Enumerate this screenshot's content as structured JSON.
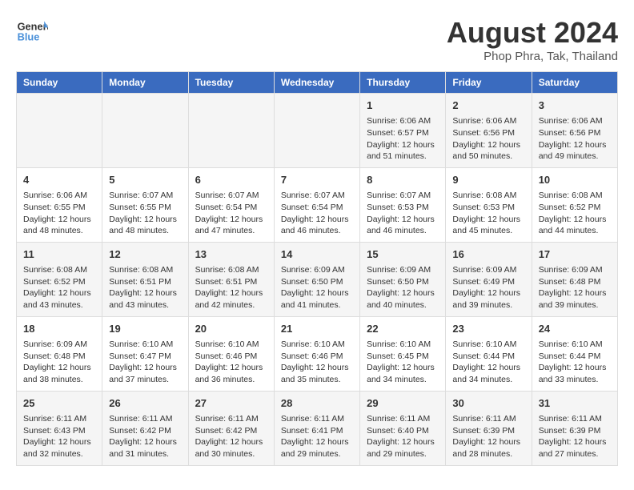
{
  "header": {
    "logo_line1": "General",
    "logo_line2": "Blue",
    "month": "August 2024",
    "location": "Phop Phra, Tak, Thailand"
  },
  "days_of_week": [
    "Sunday",
    "Monday",
    "Tuesday",
    "Wednesday",
    "Thursday",
    "Friday",
    "Saturday"
  ],
  "weeks": [
    [
      {
        "day": "",
        "info": ""
      },
      {
        "day": "",
        "info": ""
      },
      {
        "day": "",
        "info": ""
      },
      {
        "day": "",
        "info": ""
      },
      {
        "day": "1",
        "info": "Sunrise: 6:06 AM\nSunset: 6:57 PM\nDaylight: 12 hours and 51 minutes."
      },
      {
        "day": "2",
        "info": "Sunrise: 6:06 AM\nSunset: 6:56 PM\nDaylight: 12 hours and 50 minutes."
      },
      {
        "day": "3",
        "info": "Sunrise: 6:06 AM\nSunset: 6:56 PM\nDaylight: 12 hours and 49 minutes."
      }
    ],
    [
      {
        "day": "4",
        "info": "Sunrise: 6:06 AM\nSunset: 6:55 PM\nDaylight: 12 hours and 48 minutes."
      },
      {
        "day": "5",
        "info": "Sunrise: 6:07 AM\nSunset: 6:55 PM\nDaylight: 12 hours and 48 minutes."
      },
      {
        "day": "6",
        "info": "Sunrise: 6:07 AM\nSunset: 6:54 PM\nDaylight: 12 hours and 47 minutes."
      },
      {
        "day": "7",
        "info": "Sunrise: 6:07 AM\nSunset: 6:54 PM\nDaylight: 12 hours and 46 minutes."
      },
      {
        "day": "8",
        "info": "Sunrise: 6:07 AM\nSunset: 6:53 PM\nDaylight: 12 hours and 46 minutes."
      },
      {
        "day": "9",
        "info": "Sunrise: 6:08 AM\nSunset: 6:53 PM\nDaylight: 12 hours and 45 minutes."
      },
      {
        "day": "10",
        "info": "Sunrise: 6:08 AM\nSunset: 6:52 PM\nDaylight: 12 hours and 44 minutes."
      }
    ],
    [
      {
        "day": "11",
        "info": "Sunrise: 6:08 AM\nSunset: 6:52 PM\nDaylight: 12 hours and 43 minutes."
      },
      {
        "day": "12",
        "info": "Sunrise: 6:08 AM\nSunset: 6:51 PM\nDaylight: 12 hours and 43 minutes."
      },
      {
        "day": "13",
        "info": "Sunrise: 6:08 AM\nSunset: 6:51 PM\nDaylight: 12 hours and 42 minutes."
      },
      {
        "day": "14",
        "info": "Sunrise: 6:09 AM\nSunset: 6:50 PM\nDaylight: 12 hours and 41 minutes."
      },
      {
        "day": "15",
        "info": "Sunrise: 6:09 AM\nSunset: 6:50 PM\nDaylight: 12 hours and 40 minutes."
      },
      {
        "day": "16",
        "info": "Sunrise: 6:09 AM\nSunset: 6:49 PM\nDaylight: 12 hours and 39 minutes."
      },
      {
        "day": "17",
        "info": "Sunrise: 6:09 AM\nSunset: 6:48 PM\nDaylight: 12 hours and 39 minutes."
      }
    ],
    [
      {
        "day": "18",
        "info": "Sunrise: 6:09 AM\nSunset: 6:48 PM\nDaylight: 12 hours and 38 minutes."
      },
      {
        "day": "19",
        "info": "Sunrise: 6:10 AM\nSunset: 6:47 PM\nDaylight: 12 hours and 37 minutes."
      },
      {
        "day": "20",
        "info": "Sunrise: 6:10 AM\nSunset: 6:46 PM\nDaylight: 12 hours and 36 minutes."
      },
      {
        "day": "21",
        "info": "Sunrise: 6:10 AM\nSunset: 6:46 PM\nDaylight: 12 hours and 35 minutes."
      },
      {
        "day": "22",
        "info": "Sunrise: 6:10 AM\nSunset: 6:45 PM\nDaylight: 12 hours and 34 minutes."
      },
      {
        "day": "23",
        "info": "Sunrise: 6:10 AM\nSunset: 6:44 PM\nDaylight: 12 hours and 34 minutes."
      },
      {
        "day": "24",
        "info": "Sunrise: 6:10 AM\nSunset: 6:44 PM\nDaylight: 12 hours and 33 minutes."
      }
    ],
    [
      {
        "day": "25",
        "info": "Sunrise: 6:11 AM\nSunset: 6:43 PM\nDaylight: 12 hours and 32 minutes."
      },
      {
        "day": "26",
        "info": "Sunrise: 6:11 AM\nSunset: 6:42 PM\nDaylight: 12 hours and 31 minutes."
      },
      {
        "day": "27",
        "info": "Sunrise: 6:11 AM\nSunset: 6:42 PM\nDaylight: 12 hours and 30 minutes."
      },
      {
        "day": "28",
        "info": "Sunrise: 6:11 AM\nSunset: 6:41 PM\nDaylight: 12 hours and 29 minutes."
      },
      {
        "day": "29",
        "info": "Sunrise: 6:11 AM\nSunset: 6:40 PM\nDaylight: 12 hours and 29 minutes."
      },
      {
        "day": "30",
        "info": "Sunrise: 6:11 AM\nSunset: 6:39 PM\nDaylight: 12 hours and 28 minutes."
      },
      {
        "day": "31",
        "info": "Sunrise: 6:11 AM\nSunset: 6:39 PM\nDaylight: 12 hours and 27 minutes."
      }
    ]
  ]
}
